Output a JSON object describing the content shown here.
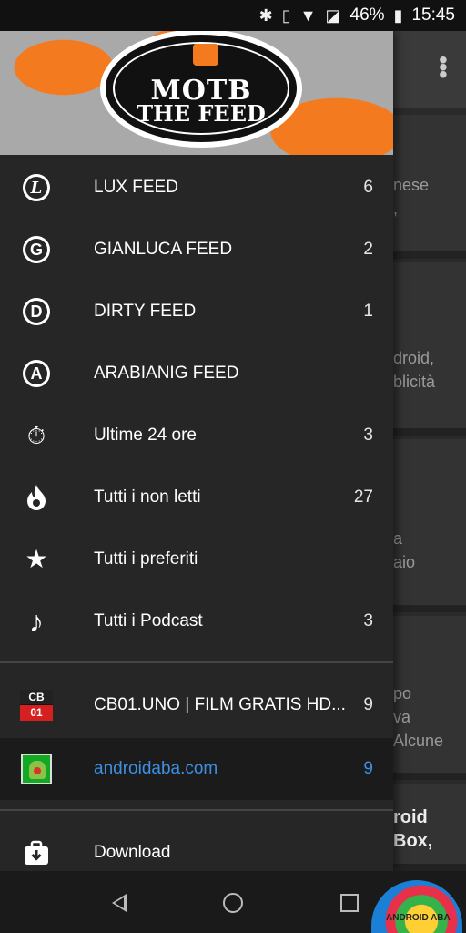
{
  "status_bar": {
    "battery": "46%",
    "time": "15:45"
  },
  "header": {
    "logo_line1": "MOTB",
    "logo_line2": "THE FEED"
  },
  "drawer_items": [
    {
      "label": "LUX FEED",
      "count": "6",
      "icon": "letter-l-circle-icon",
      "glyph": "L"
    },
    {
      "label": "GIANLUCA FEED",
      "count": "2",
      "icon": "letter-g-circle-icon",
      "glyph": "G"
    },
    {
      "label": "DIRTY FEED",
      "count": "1",
      "icon": "letter-d-circle-icon",
      "glyph": "D"
    },
    {
      "label": "ARABIANIG FEED",
      "count": "",
      "icon": "letter-a-circle-icon",
      "glyph": "A"
    },
    {
      "label": "Ultime 24 ore",
      "count": "3",
      "icon": "stopwatch-icon",
      "glyph": "⏱"
    },
    {
      "label": "Tutti i non letti",
      "count": "27",
      "icon": "flame-icon",
      "glyph": "🔥"
    },
    {
      "label": "Tutti i preferiti",
      "count": "",
      "icon": "star-icon",
      "glyph": "★"
    },
    {
      "label": "Tutti i Podcast",
      "count": "3",
      "icon": "music-note-icon",
      "glyph": "♪"
    }
  ],
  "sources": [
    {
      "label": "CB01.UNO | FILM GRATIS HD...",
      "count": "9",
      "icon": "cb01-icon",
      "logo_top": "CB",
      "logo_bottom": "01"
    },
    {
      "label": "androidaba.com",
      "count": "9",
      "icon": "androidaba-icon"
    }
  ],
  "download": {
    "label": "Download",
    "icon": "download-box-icon"
  },
  "background_snippets": [
    "nese\n,",
    "droid,\nblicità",
    "a\naio",
    "po\nva\nAlcune",
    "roid\nBox,"
  ],
  "colors": {
    "active": "#3d8fe0",
    "accent_orange": "#f47a20"
  }
}
